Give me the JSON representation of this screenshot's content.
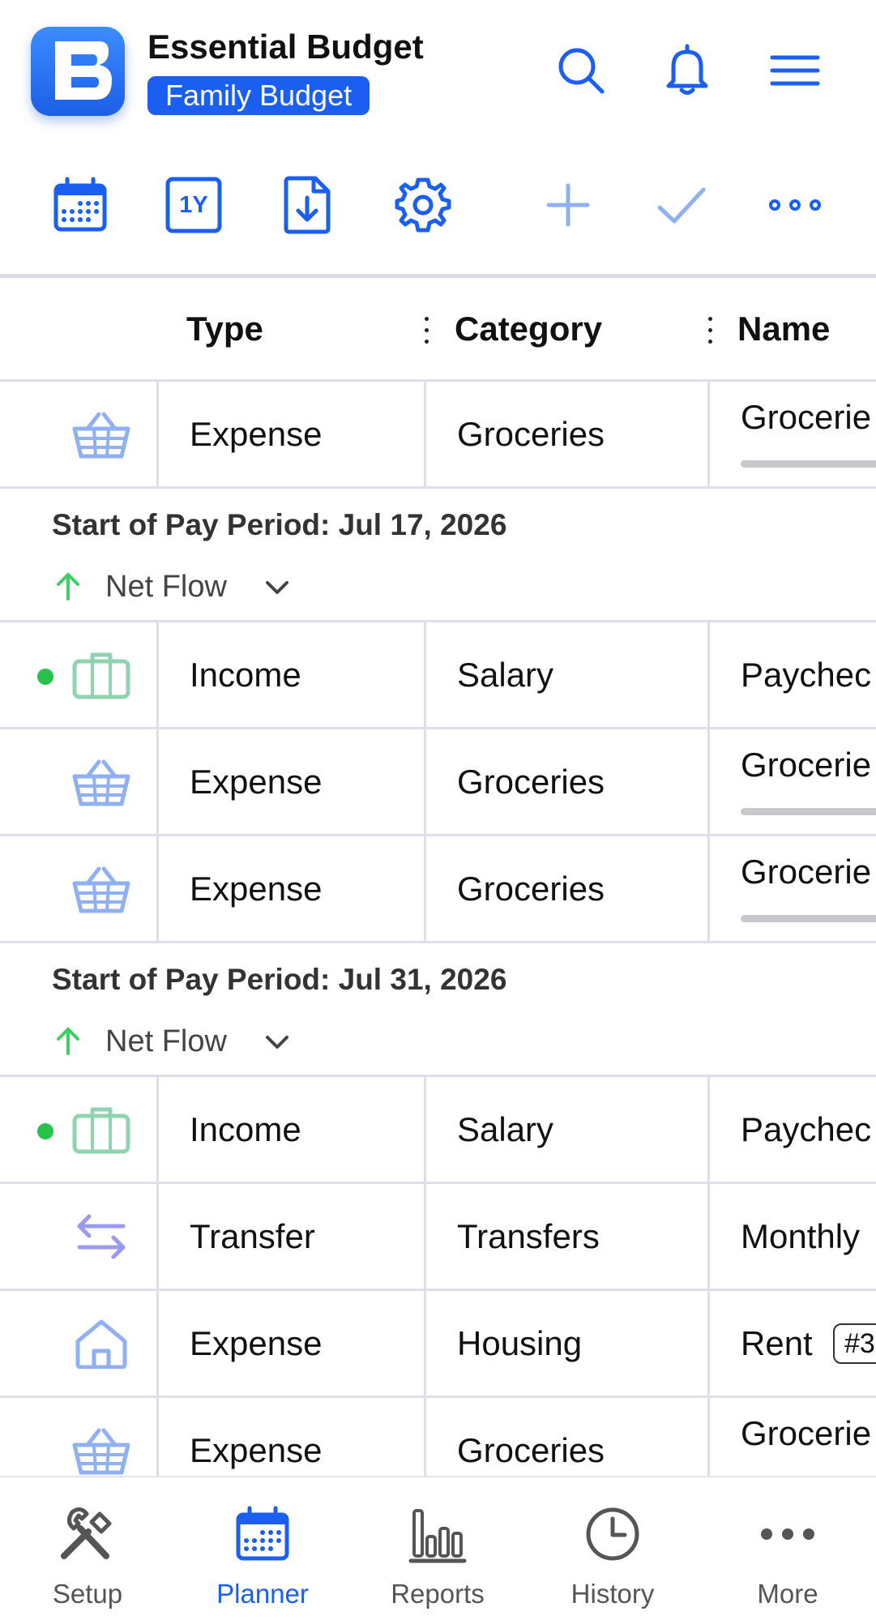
{
  "header": {
    "app_title": "Essential Budget",
    "budget_name": "Family Budget",
    "icons": [
      "search-icon",
      "bell-icon",
      "menu-icon"
    ]
  },
  "toolbar": {
    "icons": [
      "calendar-icon",
      "one-year-icon",
      "download-icon",
      "gear-icon",
      "add-icon",
      "check-icon",
      "more-icon"
    ],
    "one_year_label": "1Y"
  },
  "table": {
    "columns": [
      "Type",
      "Category",
      "Name"
    ]
  },
  "rows_top": [
    {
      "icon": "basket-icon",
      "type": "Expense",
      "category": "Groceries",
      "name": "Grocerie",
      "name_bar": true
    }
  ],
  "periods": [
    {
      "title": "Start of Pay Period: Jul 17, 2026",
      "net_flow_label": "Net Flow",
      "rows": [
        {
          "icon": "briefcase-icon",
          "dot": true,
          "type": "Income",
          "category": "Salary",
          "name": "Paychec",
          "name_bar": false
        },
        {
          "icon": "basket-icon",
          "type": "Expense",
          "category": "Groceries",
          "name": "Grocerie",
          "name_bar": true
        },
        {
          "icon": "basket-icon",
          "type": "Expense",
          "category": "Groceries",
          "name": "Grocerie",
          "name_bar": true
        }
      ]
    },
    {
      "title": "Start of Pay Period: Jul 31, 2026",
      "net_flow_label": "Net Flow",
      "rows": [
        {
          "icon": "briefcase-icon",
          "dot": true,
          "type": "Income",
          "category": "Salary",
          "name": "Paychec",
          "name_bar": false
        },
        {
          "icon": "transfer-icon",
          "type": "Transfer",
          "category": "Transfers",
          "name": "Monthly",
          "name_bar": false
        },
        {
          "icon": "house-icon",
          "type": "Expense",
          "category": "Housing",
          "name": "Rent",
          "tag": "#3",
          "name_bar": false
        },
        {
          "icon": "basket-icon",
          "type": "Expense",
          "category": "Groceries",
          "name": "Grocerie",
          "name_bar": true
        }
      ]
    }
  ],
  "tabs": [
    {
      "label": "Setup",
      "icon": "tools-icon",
      "active": false
    },
    {
      "label": "Planner",
      "icon": "calendar-icon",
      "active": true
    },
    {
      "label": "Reports",
      "icon": "bar-chart-icon",
      "active": false
    },
    {
      "label": "History",
      "icon": "clock-icon",
      "active": false
    },
    {
      "label": "More",
      "icon": "more-icon",
      "active": false
    }
  ],
  "colors": {
    "accent": "#1b5ff2",
    "income_dot": "#27c24c",
    "net_flow_arrow": "#3ccf63",
    "expense_icon": "#8fb0f2",
    "income_icon": "#8fd3b0",
    "transfer_icon": "#9a9af2"
  }
}
